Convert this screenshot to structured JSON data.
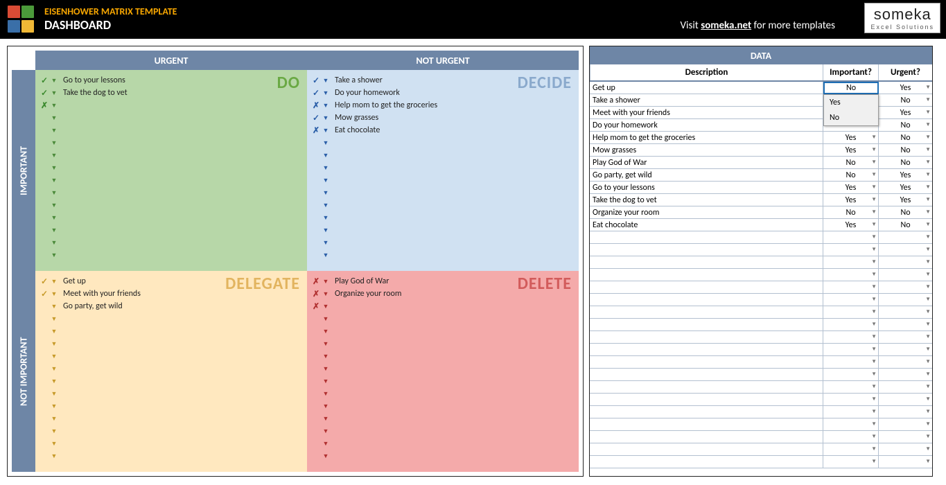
{
  "header": {
    "title": "EISENHOWER MATRIX TEMPLATE",
    "subtitle": "DASHBOARD",
    "visit_pre": "Visit ",
    "visit_link": "someka.net",
    "visit_post": " for more templates",
    "brand": "someka",
    "brand_sub": "Excel Solutions",
    "logo_colors": [
      "#d94b35",
      "#4b9a3a",
      "#3a6fa8",
      "#f0b836"
    ]
  },
  "matrix": {
    "col_urgent": "URGENT",
    "col_not_urgent": "NOT URGENT",
    "row_important": "IMPORTANT",
    "row_not_important": "NOT IMPORTANT",
    "row_slots": 15,
    "quads": {
      "do": {
        "label": "DO",
        "items": [
          {
            "mark": "✓",
            "text": "Go to your lessons"
          },
          {
            "mark": "✓",
            "text": "Take the dog to vet"
          },
          {
            "mark": "✗",
            "text": ""
          }
        ]
      },
      "decide": {
        "label": "DECIDE",
        "items": [
          {
            "mark": "✓",
            "text": "Take a shower"
          },
          {
            "mark": "✓",
            "text": "Do your homework"
          },
          {
            "mark": "✗",
            "text": "Help mom to get the groceries"
          },
          {
            "mark": "✓",
            "text": "Mow grasses"
          },
          {
            "mark": "✗",
            "text": "Eat chocolate"
          }
        ]
      },
      "delegate": {
        "label": "DELEGATE",
        "items": [
          {
            "mark": "✓",
            "text": "Get up"
          },
          {
            "mark": "✓",
            "text": "Meet with your friends"
          },
          {
            "mark": "",
            "text": "Go party, get wild"
          }
        ]
      },
      "delete": {
        "label": "DELETE",
        "items": [
          {
            "mark": "✗",
            "text": "Play God of War"
          },
          {
            "mark": "✗",
            "text": "Organize your room"
          },
          {
            "mark": "✗",
            "text": ""
          }
        ]
      }
    }
  },
  "data_table": {
    "title": "DATA",
    "cols": {
      "desc": "Description",
      "important": "Important?",
      "urgent": "Urgent?"
    },
    "active_cell": {
      "row": 0,
      "col": "important",
      "value": "No"
    },
    "dropdown": {
      "options": [
        "Yes",
        "No"
      ]
    },
    "rows": [
      {
        "desc": "Get up",
        "important": "No",
        "urgent": "Yes"
      },
      {
        "desc": "Take a shower",
        "important": "Yes",
        "urgent": "No"
      },
      {
        "desc": "Meet with your friends",
        "important": "",
        "urgent": "Yes"
      },
      {
        "desc": "Do your homework",
        "important": "",
        "urgent": "No"
      },
      {
        "desc": "Help mom to get the groceries",
        "important": "Yes",
        "urgent": "No"
      },
      {
        "desc": "Mow grasses",
        "important": "Yes",
        "urgent": "No"
      },
      {
        "desc": "Play God of War",
        "important": "No",
        "urgent": "No"
      },
      {
        "desc": "Go party, get wild",
        "important": "No",
        "urgent": "Yes"
      },
      {
        "desc": "Go to your lessons",
        "important": "Yes",
        "urgent": "Yes"
      },
      {
        "desc": "Take the dog to vet",
        "important": "Yes",
        "urgent": "Yes"
      },
      {
        "desc": "Organize your room",
        "important": "No",
        "urgent": "No"
      },
      {
        "desc": "Eat chocolate",
        "important": "Yes",
        "urgent": "No"
      }
    ],
    "blank_rows": 19
  }
}
